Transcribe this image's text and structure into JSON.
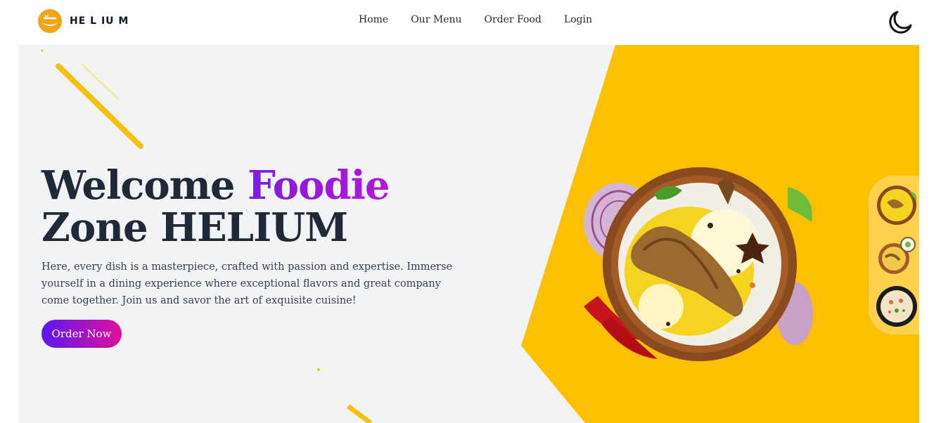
{
  "brand": {
    "name": "HE L IU M",
    "accent_color": "#fbbf00"
  },
  "nav": {
    "links": [
      "Home",
      "Our Menu",
      "Order Food",
      "Login"
    ],
    "theme_icon": "moon-icon"
  },
  "hero": {
    "headline_part1": "Welcome ",
    "headline_accent": "Foodie",
    "headline_line2": "Zone HELIUM",
    "description": "Here, every dish is a masterpiece, crafted with passion and expertise. Immerse yourself in a dining experience where exceptional flavors and great company come together. Join us and savor the art of exquisite cuisine!",
    "cta_label": "Order Now",
    "background_color": "#f2f3f5",
    "panel_color": "#fcc000",
    "accent_gradient": [
      "#7c1ee0",
      "#b515d8"
    ],
    "button_gradient": [
      "#5a18f0",
      "#e20f9a"
    ]
  },
  "dishes": [
    "biryani-plate-image",
    "chicken-biryani-thumb",
    "biryani-raita-thumb",
    "fried-rice-thumb"
  ]
}
